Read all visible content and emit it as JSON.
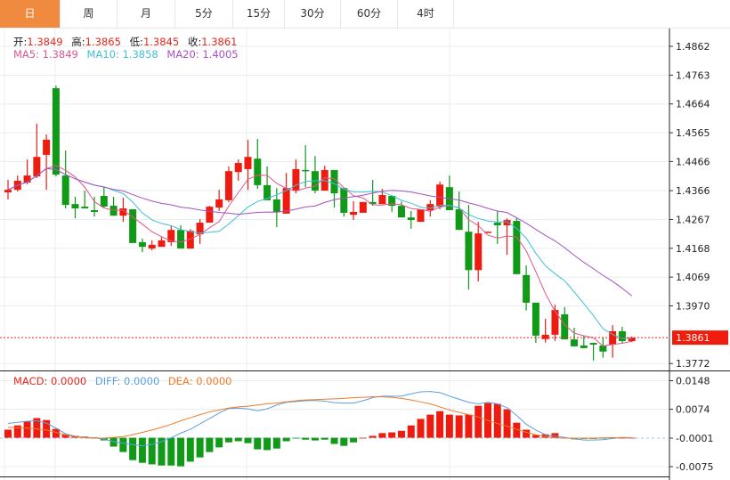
{
  "tabs": [
    {
      "label": "日",
      "active": true
    },
    {
      "label": "周"
    },
    {
      "label": "月"
    },
    {
      "label": "5分"
    },
    {
      "label": "15分"
    },
    {
      "label": "30分"
    },
    {
      "label": "60分"
    },
    {
      "label": "4时"
    }
  ],
  "ohlc_header": {
    "open_label": "开:",
    "open": "1.3849",
    "high_label": "高:",
    "high": "1.3865",
    "low_label": "低:",
    "low": "1.3845",
    "close_label": "收:",
    "close": "1.3861"
  },
  "ma_header": {
    "ma5": "MA5: 1.3849",
    "ma10": "MA10: 1.3858",
    "ma20": "MA20: 1.4005"
  },
  "macd_header": {
    "macd": "MACD: 0.0000",
    "diff": "DIFF: 0.0000",
    "dea": "DEA: 0.0000"
  },
  "colors": {
    "up": "#ee1c10",
    "down": "#109a18",
    "ma5": "#e0558a",
    "ma10": "#3fbfd6",
    "ma20": "#a550c0",
    "diff": "#5c9fe0",
    "dea": "#f07a2a",
    "accent": "#f08a3e"
  },
  "chart_data": [
    {
      "type": "candlestick",
      "price_axis": {
        "ticks": [
          "1.4862",
          "1.4763",
          "1.4664",
          "1.4565",
          "1.4466",
          "1.4366",
          "1.4267",
          "1.4168",
          "1.4069",
          "1.3970",
          "1.3772"
        ],
        "range": [
          1.3772,
          1.4862
        ]
      },
      "last_price": "1.3861",
      "moving_averages": [
        "MA5",
        "MA10",
        "MA20"
      ],
      "candles": [
        [
          1.436,
          1.4403,
          1.4336,
          1.4369
        ],
        [
          1.4369,
          1.4418,
          1.4363,
          1.44
        ],
        [
          1.4394,
          1.4473,
          1.4388,
          1.4418
        ],
        [
          1.4415,
          1.4596,
          1.4409,
          1.4482
        ],
        [
          1.4489,
          1.4559,
          1.4369,
          1.4541
        ],
        [
          1.4718,
          1.4727,
          1.4415,
          1.4421
        ],
        [
          1.4418,
          1.4504,
          1.4305,
          1.4317
        ],
        [
          1.432,
          1.4345,
          1.4271,
          1.4305
        ],
        [
          1.4311,
          1.4366,
          1.4305,
          1.4305
        ],
        [
          1.4299,
          1.4345,
          1.4277,
          1.4293
        ],
        [
          1.4348,
          1.4378,
          1.4308,
          1.4311
        ],
        [
          1.4314,
          1.4345,
          1.428,
          1.428
        ],
        [
          1.428,
          1.4342,
          1.4259,
          1.4305
        ],
        [
          1.4302,
          1.4302,
          1.4186,
          1.4186
        ],
        [
          1.4189,
          1.4201,
          1.4155,
          1.4173
        ],
        [
          1.4167,
          1.4195,
          1.4161,
          1.418
        ],
        [
          1.4173,
          1.4207,
          1.4173,
          1.4195
        ],
        [
          1.4189,
          1.4247,
          1.4176,
          1.4231
        ],
        [
          1.4231,
          1.4247,
          1.4167,
          1.4167
        ],
        [
          1.4167,
          1.4234,
          1.4167,
          1.4228
        ],
        [
          1.4216,
          1.4268,
          1.4183,
          1.4256
        ],
        [
          1.4256,
          1.4314,
          1.4256,
          1.4311
        ],
        [
          1.4308,
          1.4369,
          1.4296,
          1.4336
        ],
        [
          1.4333,
          1.4449,
          1.4327,
          1.4433
        ],
        [
          1.443,
          1.4473,
          1.44,
          1.4461
        ],
        [
          1.444,
          1.4541,
          1.4369,
          1.4482
        ],
        [
          1.4476,
          1.4544,
          1.4372,
          1.4385
        ],
        [
          1.4385,
          1.4449,
          1.4333,
          1.4333
        ],
        [
          1.4336,
          1.4375,
          1.4241,
          1.4293
        ],
        [
          1.4287,
          1.4427,
          1.4287,
          1.4375
        ],
        [
          1.4366,
          1.4473,
          1.4357,
          1.444
        ],
        [
          1.4437,
          1.4522,
          1.4378,
          1.4433
        ],
        [
          1.4433,
          1.4485,
          1.4357,
          1.4366
        ],
        [
          1.4366,
          1.4452,
          1.4366,
          1.4437
        ],
        [
          1.4437,
          1.4437,
          1.4308,
          1.4357
        ],
        [
          1.4375,
          1.4375,
          1.4277,
          1.429
        ],
        [
          1.4283,
          1.433,
          1.4265,
          1.4293
        ],
        [
          1.429,
          1.4327,
          1.429,
          1.4327
        ],
        [
          1.4327,
          1.4403,
          1.4314,
          1.432
        ],
        [
          1.432,
          1.4372,
          1.432,
          1.4351
        ],
        [
          1.4348,
          1.4348,
          1.4293,
          1.4314
        ],
        [
          1.4314,
          1.4329,
          1.4274,
          1.4274
        ],
        [
          1.4274,
          1.4296,
          1.4235,
          1.4265
        ],
        [
          1.4259,
          1.4302,
          1.4259,
          1.4302
        ],
        [
          1.4299,
          1.4333,
          1.4277,
          1.432
        ],
        [
          1.4311,
          1.4397,
          1.4302,
          1.4387
        ],
        [
          1.4378,
          1.4418,
          1.4299,
          1.4299
        ],
        [
          1.4302,
          1.4363,
          1.4231,
          1.4231
        ],
        [
          1.4225,
          1.4317,
          1.4026,
          1.4093
        ],
        [
          1.4093,
          1.4259,
          1.4054,
          1.4219
        ],
        [
          1.4222,
          1.4225,
          1.4222,
          1.4225
        ],
        [
          1.4256,
          1.4296,
          1.4183,
          1.4247
        ],
        [
          1.4247,
          1.4271,
          1.4146,
          1.4265
        ],
        [
          1.4262,
          1.4271,
          1.4079,
          1.4079
        ],
        [
          1.4076,
          1.4109,
          1.3954,
          1.3981
        ],
        [
          1.3981,
          1.3981,
          1.3843,
          1.3868
        ],
        [
          1.3856,
          1.3926,
          1.3844,
          1.3871
        ],
        [
          1.3871,
          1.3974,
          1.385,
          1.3956
        ],
        [
          1.3941,
          1.3966,
          1.3855,
          1.3855
        ],
        [
          1.3855,
          1.3895,
          1.3831,
          1.3831
        ],
        [
          1.3834,
          1.3868,
          1.3825,
          1.3825
        ],
        [
          1.3843,
          1.3843,
          1.3782,
          1.3837
        ],
        [
          1.3834,
          1.3862,
          1.3792,
          1.3813
        ],
        [
          1.3837,
          1.3904,
          1.3792,
          1.3883
        ],
        [
          1.3883,
          1.3898,
          1.3843,
          1.3849
        ],
        [
          1.3849,
          1.3865,
          1.3845,
          1.3861
        ]
      ]
    },
    {
      "type": "bar+line",
      "axis": {
        "ticks": [
          "0.0148",
          "0.0074",
          "-0.0001",
          "-0.0075"
        ],
        "range": [
          -0.0075,
          0.0148
        ]
      },
      "macd": [
        0.0021,
        0.0032,
        0.0042,
        0.0051,
        0.0046,
        0.0023,
        0.0009,
        0.0005,
        0.0003,
        0.0001,
        -0.0007,
        -0.0023,
        -0.0037,
        -0.0058,
        -0.0065,
        -0.0069,
        -0.0072,
        -0.0072,
        -0.0074,
        -0.0062,
        -0.0051,
        -0.0037,
        -0.0025,
        -0.0012,
        -0.0009,
        -0.0014,
        -0.003,
        -0.0032,
        -0.0028,
        -0.0009,
        -0.0002,
        -0.0005,
        -0.0007,
        -0.0005,
        -0.0016,
        -0.0021,
        -0.0012,
        0.0,
        0.0005,
        0.0012,
        0.0014,
        0.0018,
        0.0032,
        0.0049,
        0.006,
        0.0069,
        0.006,
        0.0058,
        0.006,
        0.0083,
        0.009,
        0.0088,
        0.0074,
        0.0039,
        0.0021,
        0.0007,
        0.0009,
        0.0012,
        -0.0002,
        -0.0004,
        -0.0003,
        -0.0003,
        -0.0002,
        0.0001,
        0.0,
        0.0
      ],
      "diff": [
        0.0037,
        0.004,
        0.0043,
        0.0044,
        0.0038,
        0.0025,
        0.001,
        0.0004,
        0.0001,
        0.0,
        -0.0004,
        -0.001,
        -0.0014,
        -0.0018,
        -0.0021,
        -0.0017,
        -0.001,
        0.0,
        0.0012,
        0.0022,
        0.0036,
        0.005,
        0.0064,
        0.0076,
        0.0077,
        0.0075,
        0.007,
        0.0075,
        0.0085,
        0.0092,
        0.0094,
        0.0096,
        0.0097,
        0.0095,
        0.0091,
        0.009,
        0.009,
        0.0096,
        0.0104,
        0.0108,
        0.0108,
        0.0108,
        0.0114,
        0.0119,
        0.012,
        0.0117,
        0.0108,
        0.01,
        0.0092,
        0.0088,
        0.0092,
        0.0088,
        0.0078,
        0.0058,
        0.0035,
        0.002,
        0.0008,
        0.0004,
        0.0001,
        -0.0003,
        -0.0006,
        -0.0006,
        -0.0005,
        -0.0002,
        0.0001,
        0.0
      ],
      "dea": [
        0.0027,
        0.0026,
        0.0025,
        0.0023,
        0.002,
        0.0014,
        0.0007,
        0.0003,
        0.0,
        -0.0001,
        -0.0001,
        0.0001,
        0.0003,
        0.0008,
        0.0014,
        0.002,
        0.0027,
        0.0035,
        0.0044,
        0.0052,
        0.006,
        0.0067,
        0.0072,
        0.0077,
        0.008,
        0.0082,
        0.0085,
        0.0088,
        0.009,
        0.0093,
        0.0096,
        0.0098,
        0.0099,
        0.01,
        0.0101,
        0.0102,
        0.0104,
        0.0105,
        0.0106,
        0.0106,
        0.0105,
        0.0102,
        0.0098,
        0.0093,
        0.0088,
        0.008,
        0.0072,
        0.0066,
        0.006,
        0.0054,
        0.0045,
        0.0037,
        0.003,
        0.0022,
        0.0014,
        0.0008,
        0.0003,
        0.0,
        -0.0001,
        -0.0001,
        -0.0001,
        -0.0001,
        0.0,
        0.0,
        0.0,
        0.0
      ]
    }
  ]
}
